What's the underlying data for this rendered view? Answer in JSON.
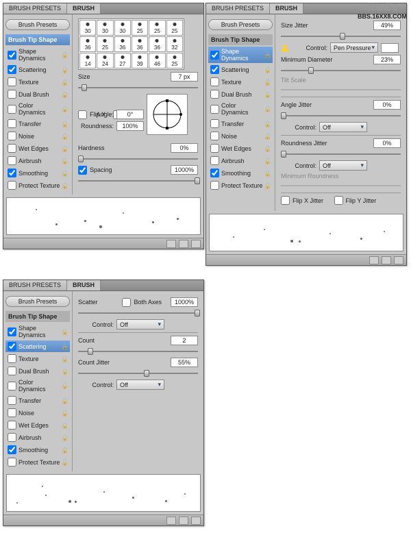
{
  "tabs": {
    "presets": "BRUSH PRESETS",
    "brush": "BRUSH"
  },
  "presetsBtn": "Brush Presets",
  "opts": {
    "tip": "Brush Tip Shape",
    "shape": "Shape Dynamics",
    "scatter": "Scattering",
    "tex": "Texture",
    "dual": "Dual Brush",
    "color": "Color Dynamics",
    "transfer": "Transfer",
    "noise": "Noise",
    "wet": "Wet Edges",
    "air": "Airbrush",
    "smooth": "Smoothing",
    "protect": "Protect Texture"
  },
  "p1": {
    "size": "Size",
    "sizeVal": "7 px",
    "flipx": "Flip X",
    "flipy": "Flip Y",
    "angle": "Angle:",
    "angleVal": "0°",
    "round": "Roundness:",
    "roundVal": "100%",
    "hard": "Hardness",
    "hardVal": "0%",
    "spacing": "Spacing",
    "spacingVal": "1000%",
    "brushes": [
      "30",
      "30",
      "30",
      "25",
      "25",
      "25",
      "36",
      "25",
      "36",
      "36",
      "36",
      "32",
      "14",
      "24",
      "27",
      "39",
      "46",
      "25"
    ]
  },
  "p2": {
    "sizeJ": "Size Jitter",
    "sizeJV": "49%",
    "ctrl": "Control:",
    "pen": "Pen Pressure",
    "minD": "Minimum Diameter",
    "minDV": "23%",
    "tilt": "Tilt Scale",
    "angleJ": "Angle Jitter",
    "angleJV": "0%",
    "off": "Off",
    "roundJ": "Roundness Jitter",
    "roundJV": "0%",
    "minR": "Minimum Roundness",
    "flipXJ": "Flip X Jitter",
    "flipYJ": "Flip Y Jitter"
  },
  "p3": {
    "scatter": "Scatter",
    "both": "Both Axes",
    "scatterV": "1000%",
    "ctrl": "Control:",
    "off": "Off",
    "count": "Count",
    "countV": "2",
    "countJ": "Count Jitter",
    "countJV": "55%"
  }
}
